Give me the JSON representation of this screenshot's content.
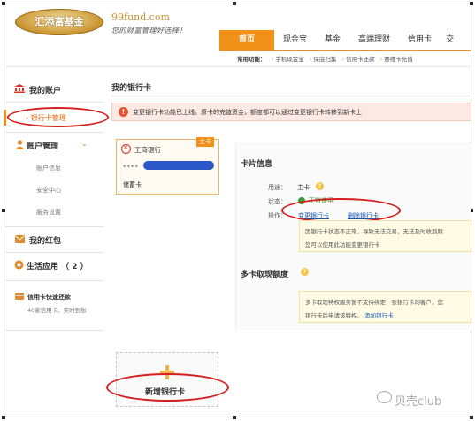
{
  "header": {
    "logo_text": "汇添富基金",
    "site_url": "99fund.com",
    "slogan": "您的财富管理好选择！",
    "nav": [
      "首页",
      "现金宝",
      "基金",
      "高端理财",
      "信用卡",
      "交"
    ],
    "quick_label": "常用功能：",
    "quick_links": [
      "手机现金宝",
      "保底归集",
      "信用卡还款",
      "赛维卡充值"
    ]
  },
  "sidebar": {
    "my_account": "我的账户",
    "bank_card_mgmt": "银行卡管理",
    "account_mgmt": "账户管理",
    "account_sub": [
      "账户信息",
      "安全中心",
      "服务设置"
    ],
    "red_packet": "我的红包",
    "life_app": "生活应用 （ 2 ）",
    "credit_title": "信用卡快速还款",
    "credit_sub": "40家信用卡、实时到账"
  },
  "main": {
    "title": "我的银行卡",
    "notice": "变更银行卡功能已上线。原卡的充值资金，额度都可以通过变更银行卡转移到新卡上",
    "card": {
      "bank": "工商银行",
      "tag": "主卡",
      "number_mask": "****",
      "type": "储蓄卡"
    },
    "detail": {
      "title": "卡片信息",
      "usage_label": "用途：",
      "usage_value": "主卡",
      "status_label": "状态：",
      "status_value": "正常使用",
      "op_label": "操作：",
      "change_link": "变更银行卡",
      "delete_link": "删除银行卡",
      "tip_lines": [
        "因银行卡状态不正常，导致无法交易，无法及时收到赎",
        "您可以使用此功能变更银行卡"
      ],
      "multi_title": "多卡取现额度",
      "tip2_lines": [
        "多卡取现特权服务暂不支持绑定一张银行卡的客户，您",
        "银行卡后申请该特权。"
      ],
      "add_card_link": "添加银行卡"
    },
    "add_card_label": "新增银行卡"
  },
  "watermark": "贝壳club",
  "colors": {
    "accent": "#f29118",
    "link": "#1a58b8",
    "alert": "#d61e1e"
  }
}
